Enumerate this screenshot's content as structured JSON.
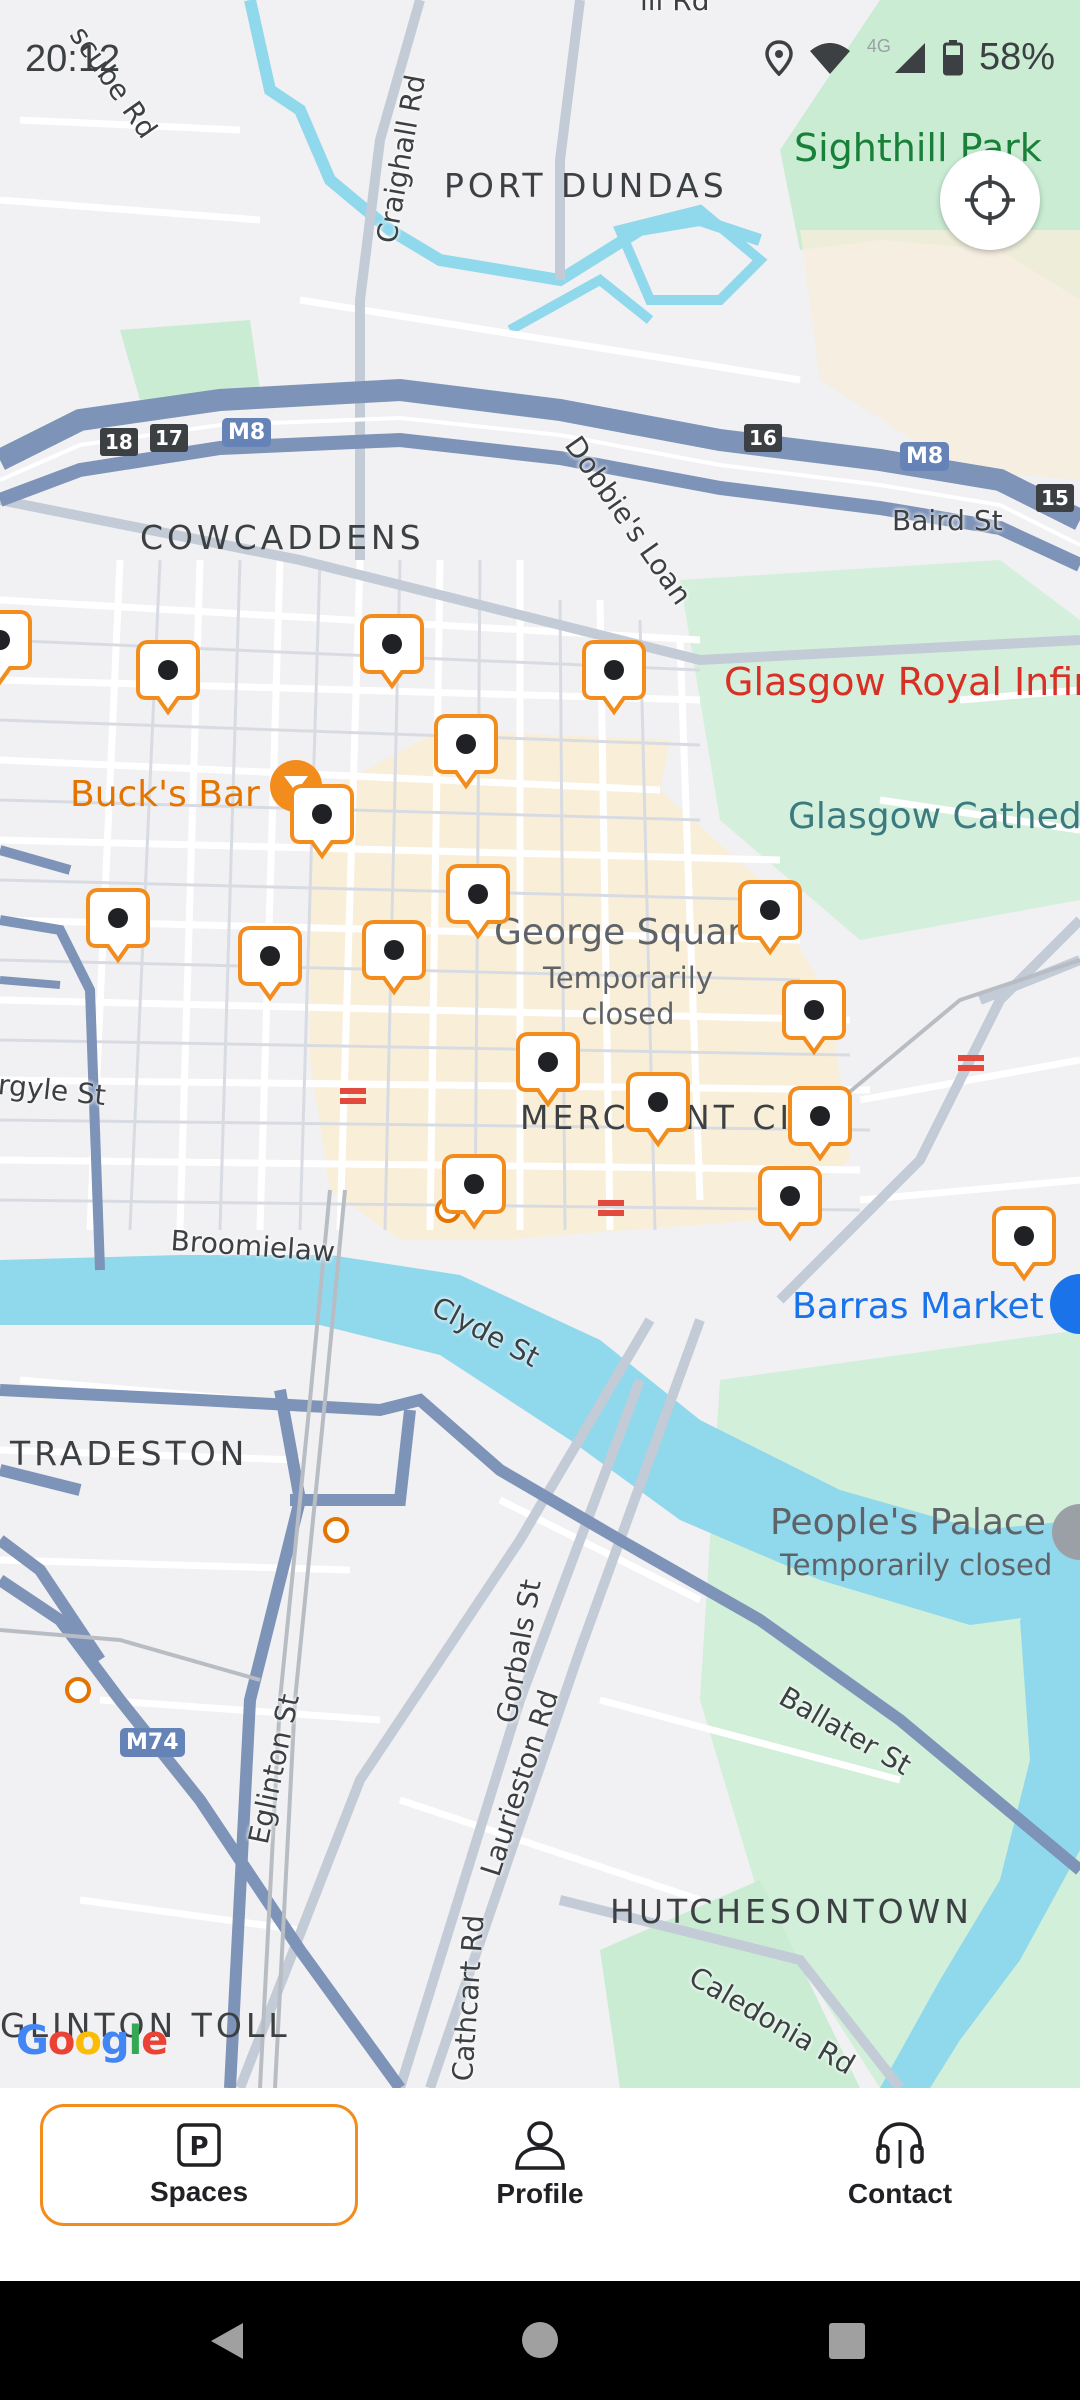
{
  "status_bar": {
    "time": "20:12",
    "network_type": "4G",
    "battery": "58%",
    "icons": [
      "location-icon",
      "wifi-icon",
      "cellular-signal-icon",
      "battery-icon"
    ]
  },
  "map": {
    "districts": [
      "PORT DUNDAS",
      "COWCADDENS",
      "MERCHANT CITY",
      "TRADESTON",
      "HUTCHESONTOWN",
      "GLINTON TOLL"
    ],
    "streets": [
      "scube Rd",
      "Craighall Rd",
      "Dobbie's Loan",
      "Baird St",
      "rgyle St",
      "Broomielaw",
      "Clyde St",
      "Eglinton St",
      "Gorbals St",
      "Laurieston Rd",
      "Cathcart Rd",
      "Ballater St",
      "Caledonia Rd",
      "ill Rd"
    ],
    "pois": {
      "sighthill_park": "Sighthill Park",
      "royal_infirmary": "Glasgow Royal Infirm",
      "cathedral": "Glasgow Cathed",
      "bucks_bar": "Buck's Bar",
      "george_square": "George Squar",
      "george_square_status": "Temporarily closed",
      "barras_market": "Barras Market",
      "peoples_palace": "People's Palace",
      "peoples_palace_status": "Temporarily closed"
    },
    "motorway_shields": [
      "M8",
      "M8",
      "M74"
    ],
    "junction_numbers": [
      "18",
      "17",
      "16",
      "15"
    ],
    "parking_pin_count": 20,
    "attribution": "Google",
    "colors": {
      "pin_orange": "#f28c1c",
      "water": "#90d8ec",
      "park": "#c9ecd3",
      "motorway": "#7d93b8",
      "highlight_area": "#f9efd8"
    }
  },
  "locate_button": {
    "icon": "crosshair-icon"
  },
  "bottom_nav": {
    "items": [
      {
        "label": "Spaces",
        "icon": "parking-icon",
        "active": true
      },
      {
        "label": "Profile",
        "icon": "person-icon",
        "active": false
      },
      {
        "label": "Contact",
        "icon": "headset-icon",
        "active": false
      }
    ]
  },
  "system_nav": {
    "icons": [
      "back-icon",
      "home-icon",
      "recents-icon"
    ]
  }
}
